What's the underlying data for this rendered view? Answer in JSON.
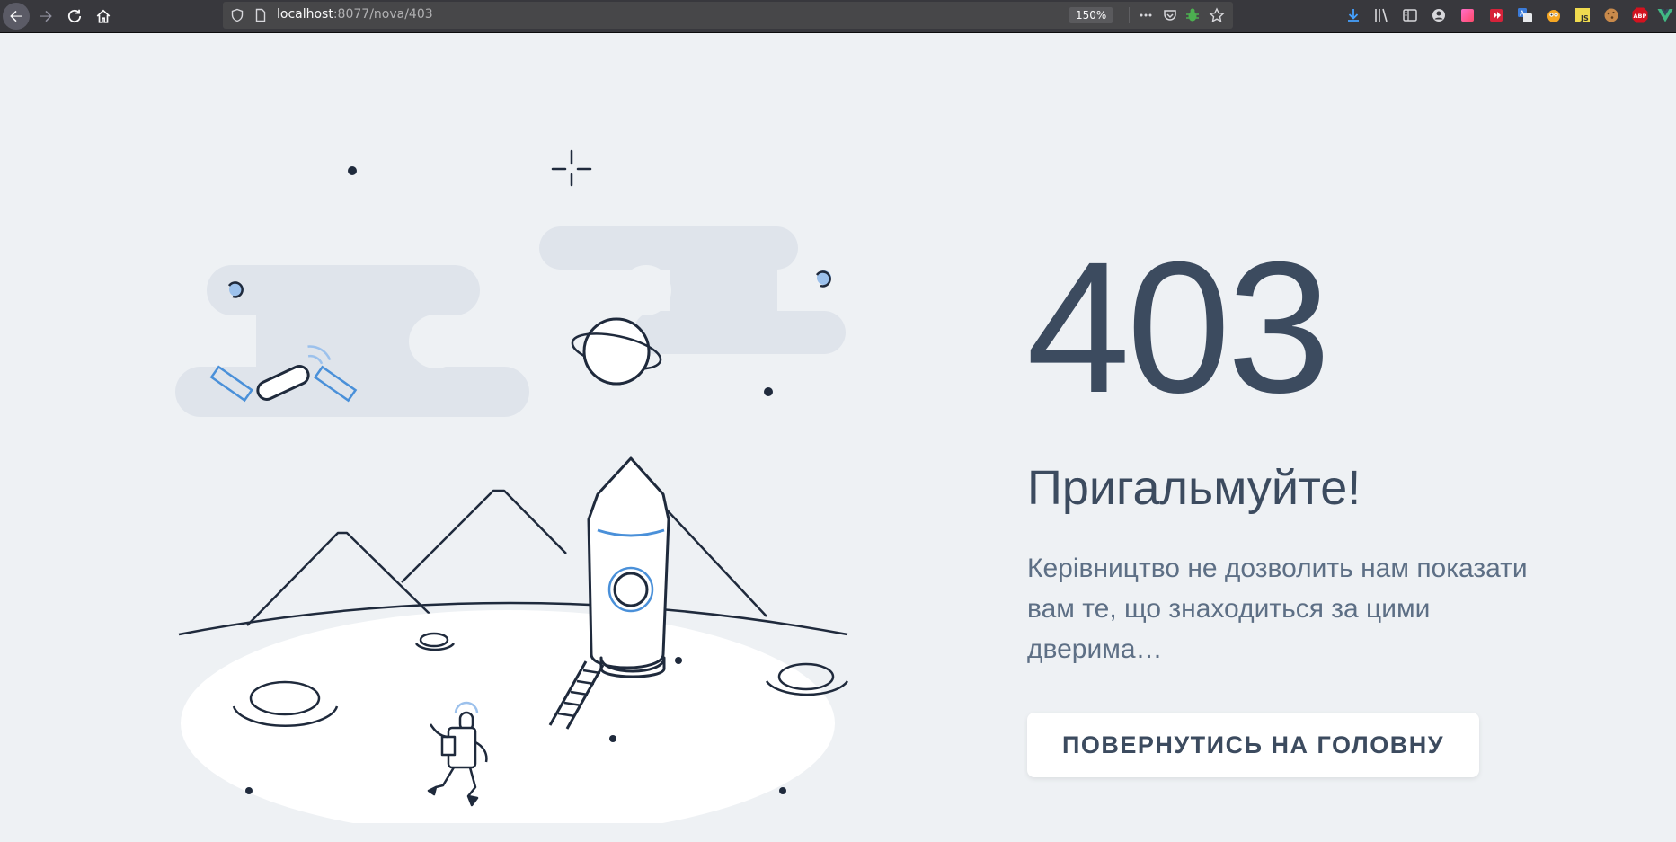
{
  "browser": {
    "url_host": "localhost",
    "url_path": ":8077/nova/403",
    "zoom": "150%",
    "nav": {
      "back": "back-icon",
      "forward": "forward-icon",
      "reload": "reload-icon",
      "home": "home-icon"
    },
    "extensions": [
      "download-icon",
      "library-icon",
      "sidebar-icon",
      "account-icon",
      "color-extension-icon",
      "media-extension-icon",
      "translate-extension-icon",
      "owl-extension-icon",
      "js-extension-icon",
      "cookie-extension-icon",
      "adblock-extension-icon",
      "vue-devtools-icon"
    ],
    "extension_labels": {
      "js": "JS",
      "abp": "ABP"
    }
  },
  "error": {
    "code": "403",
    "title": "Пригальмуйте!",
    "message": "Керівництво не дозволить нам показати вам те, що знаходиться за цими дверима…",
    "button_label": "ПОВЕРНУТИСЬ НА ГОЛОВНУ"
  },
  "colors": {
    "background": "#eef1f4",
    "text_dark": "#3c4b5f",
    "text_muted": "#5d6f85",
    "accent_blue": "#4a90d9",
    "line_dark": "#1f2a3c"
  }
}
